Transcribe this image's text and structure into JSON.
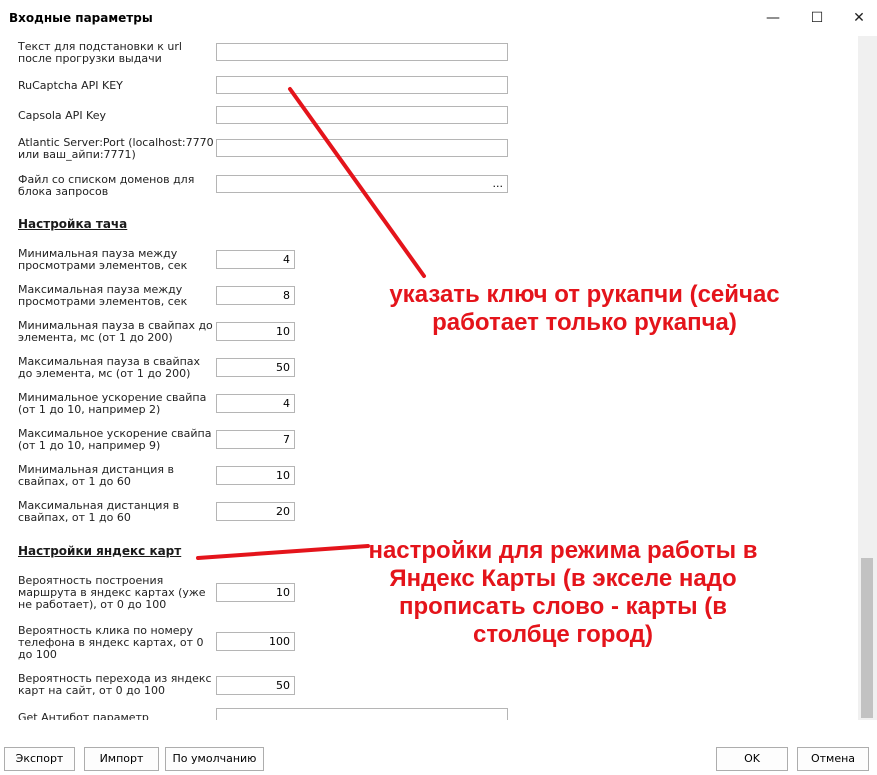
{
  "window": {
    "title": "Входные параметры",
    "minimize": "—",
    "maximize": "☐",
    "close": "✕"
  },
  "fields_top": [
    {
      "label": "Текст для подстановки к url после прогрузки выдачи",
      "value": ""
    },
    {
      "label": "RuCaptcha API KEY",
      "value": ""
    },
    {
      "label": "Capsola API Key",
      "value": ""
    },
    {
      "label": "Atlantic Server:Port (localhost:7770 или ваш_айпи:7771)",
      "value": ""
    },
    {
      "label": "Файл со списком доменов для блока запросов",
      "value": "",
      "browse": "..."
    }
  ],
  "touch_section": {
    "title": "Настройка тача",
    "rows": [
      {
        "label": "Минимальная пауза между просмотрами элементов, сек",
        "value": "4"
      },
      {
        "label": "Максимальная пауза между просмотрами элементов, сек",
        "value": "8"
      },
      {
        "label": "Минимальная пауза в свайпах до элемента, мс (от 1 до 200)",
        "value": "10"
      },
      {
        "label": "Максимальная пауза в свайпах до элемента, мс (от 1 до 200)",
        "value": "50"
      },
      {
        "label": "Минимальное ускорение свайпа (от 1 до 10, например 2)",
        "value": "4"
      },
      {
        "label": "Максимальное ускорение свайпа (от 1 до 10, например 9)",
        "value": "7"
      },
      {
        "label": "Минимальная дистанция в свайпах, от 1 до 60",
        "value": "10"
      },
      {
        "label": "Максимальная дистанция в свайпах, от 1 до 60",
        "value": "20"
      }
    ]
  },
  "maps_section": {
    "title": "Настройки яндекс карт",
    "rows": [
      {
        "label": "Вероятность построения маршрута в яндекс картах (уже не работает), от 0 до 100",
        "value": "10"
      },
      {
        "label": "Вероятность клика по номеру телефона в яндекс картах, от 0 до 100",
        "value": "100"
      },
      {
        "label": "Вероятность перехода из яндекс карт на сайт, от 0 до 100",
        "value": "50"
      }
    ]
  },
  "antibot": {
    "label": "Get Антибот параметр",
    "value": ""
  },
  "annotations": {
    "captcha_note": "указать ключ от рукапчи (сейчас работает только рукапча)",
    "maps_note": "настройки для режима работы в Яндекс Карты (в экселе надо прописать слово - карты (в столбце город)",
    "color": "#e4141b"
  },
  "buttons": {
    "export": "Экспорт",
    "import": "Импорт",
    "defaults": "По умолчанию",
    "ok": "OK",
    "cancel": "Отмена"
  }
}
